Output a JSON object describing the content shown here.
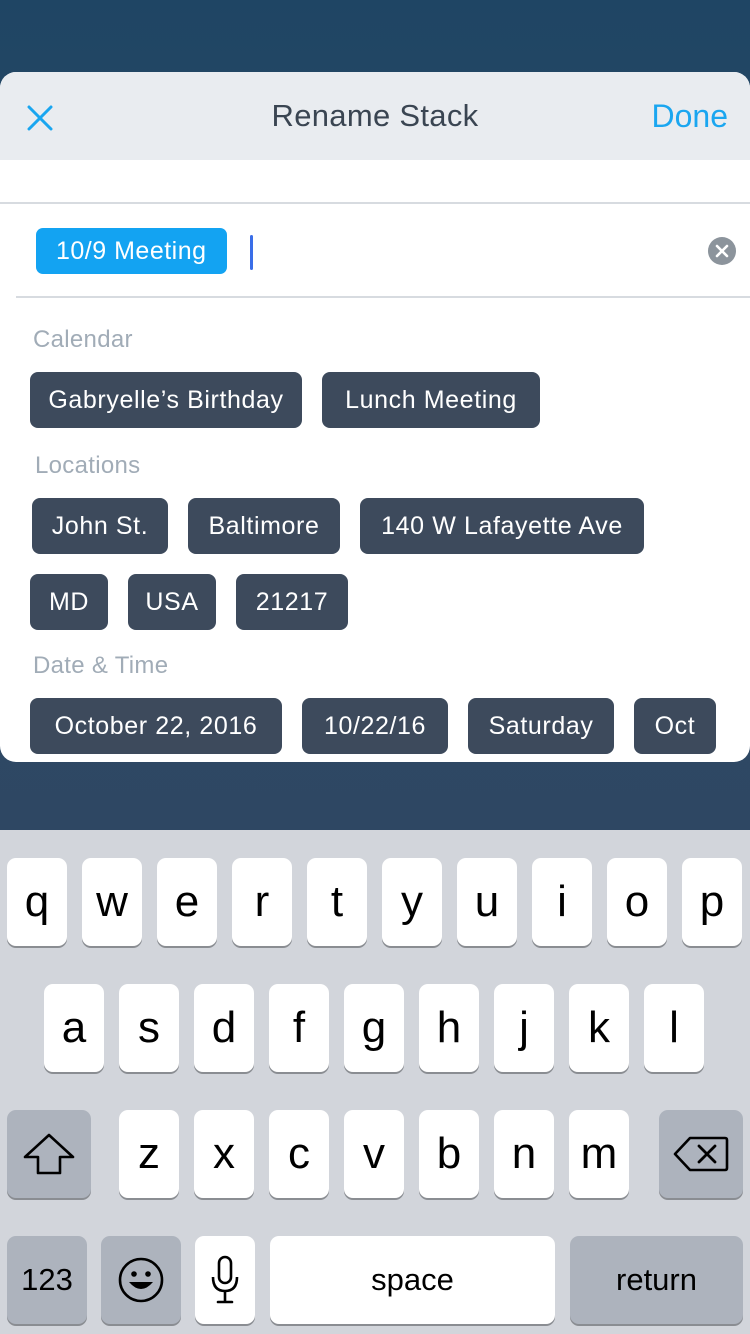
{
  "header": {
    "title": "Rename Stack",
    "done_label": "Done",
    "close_icon": "close-icon"
  },
  "input": {
    "token": "10/9 Meeting",
    "clear_icon": "clear-icon"
  },
  "sections": {
    "calendar": {
      "label": "Calendar",
      "chips": [
        "Gabryelle’s Birthday",
        "Lunch Meeting"
      ]
    },
    "locations": {
      "label": "Locations",
      "chips": [
        "John St.",
        "Baltimore",
        "140 W Lafayette Ave",
        "MD",
        "USA",
        "21217"
      ]
    },
    "datetime": {
      "label": "Date & Time",
      "chips": [
        "October 22, 2016",
        "10/22/16",
        "Saturday",
        "Oct"
      ]
    }
  },
  "keyboard": {
    "row1": [
      "q",
      "w",
      "e",
      "r",
      "t",
      "y",
      "u",
      "i",
      "o",
      "p"
    ],
    "row2": [
      "a",
      "s",
      "d",
      "f",
      "g",
      "h",
      "j",
      "k",
      "l"
    ],
    "row3": [
      "z",
      "x",
      "c",
      "v",
      "b",
      "n",
      "m"
    ],
    "numbers_label": "123",
    "space_label": "space",
    "return_label": "return"
  },
  "colors": {
    "accent": "#1aa6f0",
    "token": "#13a3f2",
    "chip": "#3d4a5c"
  }
}
